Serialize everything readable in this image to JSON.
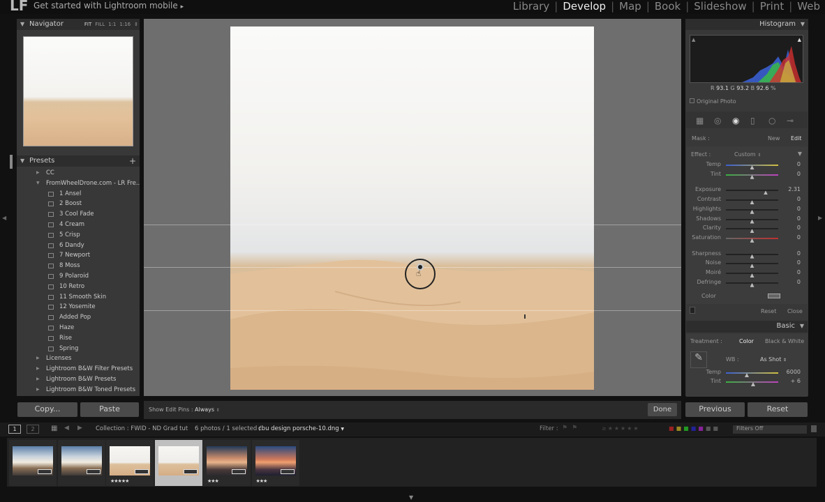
{
  "app": {
    "logo": "LF",
    "mobile_link": "Get started with Lightroom mobile",
    "mobile_arrow": "▸"
  },
  "modules": {
    "items": [
      "Library",
      "Develop",
      "Map",
      "Book",
      "Slideshow",
      "Print",
      "Web"
    ],
    "active": "Develop"
  },
  "navigator": {
    "title": "Navigator",
    "zoom_options": [
      "FIT",
      "FILL",
      "1:1",
      "1:16"
    ]
  },
  "presets": {
    "title": "Presets",
    "add": "+",
    "items": [
      {
        "label": "CC",
        "type": "folder",
        "open": false
      },
      {
        "label": "FromWheelDrone.com - LR Fre...",
        "type": "folder",
        "open": true
      },
      {
        "label": "1 Ansel",
        "type": "preset"
      },
      {
        "label": "2 Boost",
        "type": "preset"
      },
      {
        "label": "3 Cool Fade",
        "type": "preset"
      },
      {
        "label": "4 Cream",
        "type": "preset"
      },
      {
        "label": "5 Crisp",
        "type": "preset"
      },
      {
        "label": "6 Dandy",
        "type": "preset"
      },
      {
        "label": "7 Newport",
        "type": "preset"
      },
      {
        "label": "8 Moss",
        "type": "preset"
      },
      {
        "label": "9 Polaroid",
        "type": "preset"
      },
      {
        "label": "10 Retro",
        "type": "preset"
      },
      {
        "label": "11 Smooth Skin",
        "type": "preset"
      },
      {
        "label": "12 Yosemite",
        "type": "preset"
      },
      {
        "label": "Added Pop",
        "type": "preset"
      },
      {
        "label": "Haze",
        "type": "preset"
      },
      {
        "label": "Rise",
        "type": "preset"
      },
      {
        "label": "Spring",
        "type": "preset"
      },
      {
        "label": "Licenses",
        "type": "folder",
        "open": false
      },
      {
        "label": "Lightroom B&W Filter Presets",
        "type": "folder",
        "open": false
      },
      {
        "label": "Lightroom B&W Presets",
        "type": "folder",
        "open": false
      },
      {
        "label": "Lightroom B&W Toned Presets",
        "type": "folder",
        "open": false
      }
    ]
  },
  "left_buttons": {
    "copy": "Copy...",
    "paste": "Paste"
  },
  "toolbar": {
    "show_edit_pins_label": "Show Edit Pins :",
    "show_edit_pins_value": "Always",
    "done": "Done"
  },
  "histogram": {
    "title": "Histogram",
    "r_label": "R",
    "r": "93.1",
    "g_label": "G",
    "g": "93.2",
    "b_label": "B",
    "b": "92.6",
    "unit": "%",
    "original_photo": "Original Photo"
  },
  "mask": {
    "label": "Mask :",
    "new": "New",
    "edit": "Edit"
  },
  "effect": {
    "label": "Effect :",
    "value": "Custom",
    "sliders": [
      {
        "label": "Temp",
        "value": "0",
        "pos": 0.5,
        "gap_before": false
      },
      {
        "label": "Tint",
        "value": "0",
        "pos": 0.5,
        "gap_before": false
      },
      {
        "label": "Exposure",
        "value": "2.31",
        "pos": 0.76,
        "gap_before": true
      },
      {
        "label": "Contrast",
        "value": "0",
        "pos": 0.5,
        "gap_before": false
      },
      {
        "label": "Highlights",
        "value": "0",
        "pos": 0.5,
        "gap_before": false
      },
      {
        "label": "Shadows",
        "value": "0",
        "pos": 0.5,
        "gap_before": false
      },
      {
        "label": "Clarity",
        "value": "0",
        "pos": 0.5,
        "gap_before": false
      },
      {
        "label": "Saturation",
        "value": "0",
        "pos": 0.5,
        "gap_before": false
      },
      {
        "label": "Sharpness",
        "value": "0",
        "pos": 0.5,
        "gap_before": true
      },
      {
        "label": "Noise",
        "value": "0",
        "pos": 0.5,
        "gap_before": false
      },
      {
        "label": "Moiré",
        "value": "0",
        "pos": 0.5,
        "gap_before": false
      },
      {
        "label": "Defringe",
        "value": "0",
        "pos": 0.5,
        "gap_before": false
      }
    ],
    "color_label": "Color",
    "reset": "Reset",
    "close": "Close"
  },
  "basic": {
    "title": "Basic",
    "treatment_label": "Treatment :",
    "treatment_color": "Color",
    "treatment_bw": "Black & White",
    "wb_label": "WB :",
    "wb_value": "As Shot",
    "temp_label": "Temp",
    "temp_value": "6000",
    "temp_pos": 0.4,
    "tint_label": "Tint",
    "tint_value": "+ 6",
    "tint_pos": 0.52
  },
  "right_buttons": {
    "previous": "Previous",
    "reset": "Reset"
  },
  "filmstrip_bar": {
    "page1": "1",
    "page2": "2",
    "collection": "Collection : FWID - ND Grad tut",
    "count": "6 photos / 1 selected /",
    "filename": "cbu design porsche-10.dng",
    "filter_label": "Filter :",
    "filters_off": "Filters Off"
  },
  "filmstrip": [
    {
      "stars": "",
      "selected": false,
      "style": "cloud"
    },
    {
      "stars": "",
      "selected": false,
      "style": "cloud"
    },
    {
      "stars": "★★★★★",
      "selected": false,
      "style": "dune"
    },
    {
      "stars": "",
      "selected": true,
      "style": "dune"
    },
    {
      "stars": "★★★",
      "selected": false,
      "style": "sunset"
    },
    {
      "stars": "★★★",
      "selected": false,
      "style": "sunset2"
    }
  ],
  "colors": {
    "accent": "#e8e8e8",
    "panel": "#383838",
    "background": "#111111"
  }
}
